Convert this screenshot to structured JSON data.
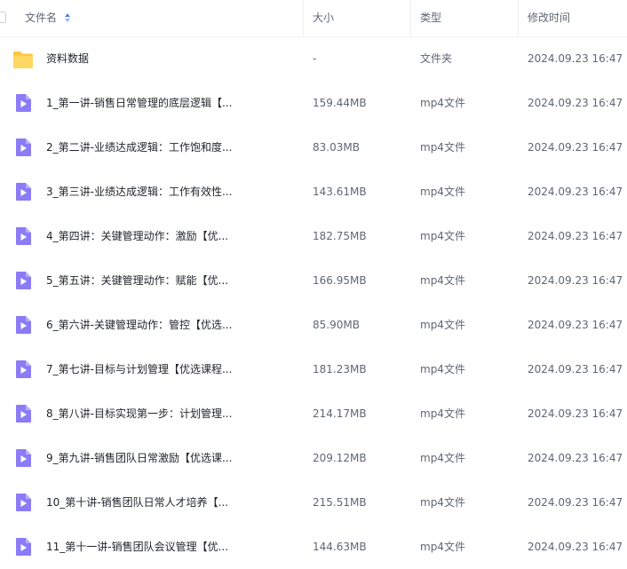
{
  "header": {
    "name_label": "文件名",
    "size_label": "大小",
    "type_label": "类型",
    "time_label": "修改时间"
  },
  "colors": {
    "folder": "#ffc83d",
    "video": "#8b7cf6",
    "sort_active": "#4d80ff"
  },
  "rows": [
    {
      "icon": "folder-icon",
      "name": "资料数据",
      "size": "-",
      "type": "文件夹",
      "time": "2024.09.23 16:47"
    },
    {
      "icon": "video-file-icon",
      "name": "1_第一讲-销售日常管理的底层逻辑【...",
      "size": "159.44MB",
      "type": "mp4文件",
      "time": "2024.09.23 16:47"
    },
    {
      "icon": "video-file-icon",
      "name": "2_第二讲-业绩达成逻辑：工作饱和度...",
      "size": "83.03MB",
      "type": "mp4文件",
      "time": "2024.09.23 16:47"
    },
    {
      "icon": "video-file-icon",
      "name": "3_第三讲-业绩达成逻辑：工作有效性...",
      "size": "143.61MB",
      "type": "mp4文件",
      "time": "2024.09.23 16:47"
    },
    {
      "icon": "video-file-icon",
      "name": "4_第四讲：关键管理动作：激励【优...",
      "size": "182.75MB",
      "type": "mp4文件",
      "time": "2024.09.23 16:47"
    },
    {
      "icon": "video-file-icon",
      "name": "5_第五讲：关键管理动作：赋能【优...",
      "size": "166.95MB",
      "type": "mp4文件",
      "time": "2024.09.23 16:47"
    },
    {
      "icon": "video-file-icon",
      "name": "6_第六讲-关键管理动作：管控【优选...",
      "size": "85.90MB",
      "type": "mp4文件",
      "time": "2024.09.23 16:47"
    },
    {
      "icon": "video-file-icon",
      "name": "7_第七讲-目标与计划管理【优选课程...",
      "size": "181.23MB",
      "type": "mp4文件",
      "time": "2024.09.23 16:47"
    },
    {
      "icon": "video-file-icon",
      "name": "8_第八讲-目标实现第一步：计划管理...",
      "size": "214.17MB",
      "type": "mp4文件",
      "time": "2024.09.23 16:47"
    },
    {
      "icon": "video-file-icon",
      "name": "9_第九讲-销售团队日常激励【优选课...",
      "size": "209.12MB",
      "type": "mp4文件",
      "time": "2024.09.23 16:47"
    },
    {
      "icon": "video-file-icon",
      "name": "10_第十讲-销售团队日常人才培养【...",
      "size": "215.51MB",
      "type": "mp4文件",
      "time": "2024.09.23 16:47"
    },
    {
      "icon": "video-file-icon",
      "name": "11_第十一讲-销售团队会议管理【优...",
      "size": "144.63MB",
      "type": "mp4文件",
      "time": "2024.09.23 16:47"
    }
  ]
}
